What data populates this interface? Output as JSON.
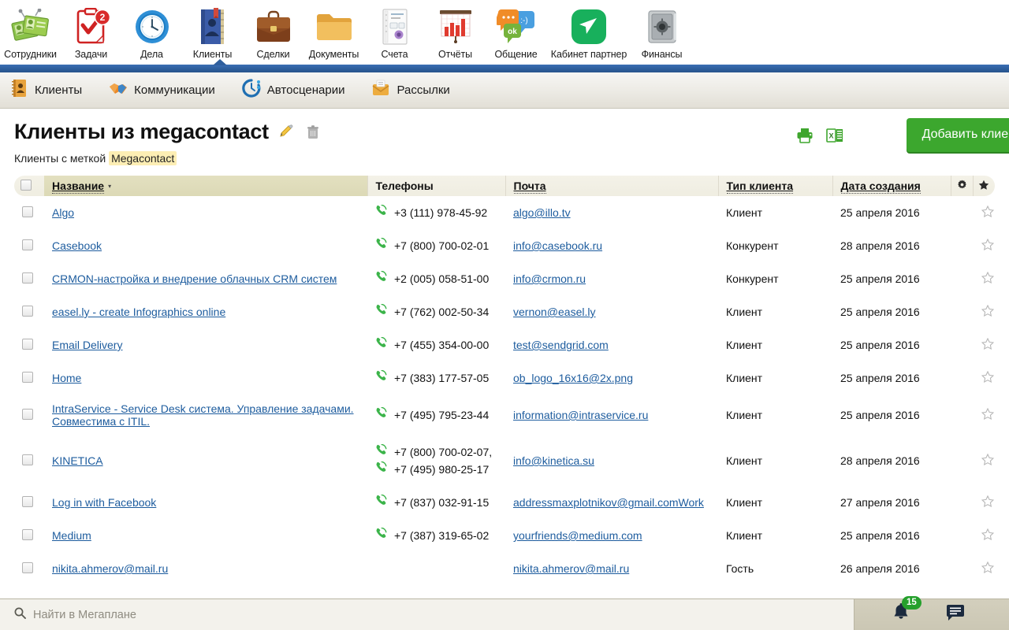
{
  "topbar": {
    "items": [
      {
        "label": "Сотрудники",
        "icon": "employees-icon",
        "badge": null
      },
      {
        "label": "Задачи",
        "icon": "tasks-clipboard-icon",
        "badge": "2"
      },
      {
        "label": "Дела",
        "icon": "clock-icon",
        "badge": null
      },
      {
        "label": "Клиенты",
        "icon": "address-book-icon",
        "badge": null,
        "active": true
      },
      {
        "label": "Сделки",
        "icon": "briefcase-icon",
        "badge": null
      },
      {
        "label": "Документы",
        "icon": "folder-icon",
        "badge": null
      },
      {
        "label": "Счета",
        "icon": "invoice-icon",
        "badge": null
      },
      {
        "label": "Отчёты",
        "icon": "bar-chart-icon",
        "badge": null
      },
      {
        "label": "Общение",
        "icon": "chat-bubbles-icon",
        "badge": null
      },
      {
        "label": "Кабинет партнер",
        "icon": "partner-cabinet-icon",
        "badge": null
      },
      {
        "label": "Финансы",
        "icon": "safe-icon",
        "badge": null
      }
    ]
  },
  "subnav": {
    "items": [
      {
        "label": "Клиенты",
        "icon": "address-book-icon",
        "active": true
      },
      {
        "label": "Коммуникации",
        "icon": "handshake-icon",
        "active": false
      },
      {
        "label": "Автосценарии",
        "icon": "auto-scenario-icon",
        "active": false
      },
      {
        "label": "Рассылки",
        "icon": "mailing-icon",
        "active": false
      }
    ]
  },
  "header": {
    "title": "Клиенты из megacontact",
    "edit_icon": "pencil-icon",
    "delete_icon": "trash-icon",
    "subtitle_prefix": "Клиенты с меткой",
    "subtitle_tag": "Megacontact",
    "print_icon": "printer-icon",
    "export_icon": "excel-export-icon",
    "add_button_label": "Добавить клиента"
  },
  "table": {
    "columns": [
      {
        "key": "select",
        "label": ""
      },
      {
        "key": "name",
        "label": "Название",
        "sorted": true,
        "sort_caret": "▾"
      },
      {
        "key": "phones",
        "label": "Телефоны"
      },
      {
        "key": "mail",
        "label": "Почта"
      },
      {
        "key": "type",
        "label": "Тип клиента"
      },
      {
        "key": "created",
        "label": "Дата создания"
      },
      {
        "key": "settings",
        "label": "",
        "icon": "gear-icon"
      },
      {
        "key": "favorite",
        "label": "",
        "icon": "star-icon"
      }
    ],
    "rows": [
      {
        "name": "Algo",
        "phones": [
          "+3 (111) 978-45-92"
        ],
        "mail": "algo@illo.tv",
        "type": "Клиент",
        "created": "25 апреля 2016",
        "starred": false
      },
      {
        "name": "Casebook",
        "phones": [
          "+7 (800) 700-02-01"
        ],
        "mail": "info@casebook.ru",
        "type": "Конкурент",
        "created": "28 апреля 2016",
        "starred": false
      },
      {
        "name": "CRMON-настройка и внедрение облачных CRM систем",
        "phones": [
          "+2 (005) 058-51-00"
        ],
        "mail": "info@crmon.ru",
        "type": "Конкурент",
        "created": "25 апреля 2016",
        "starred": false
      },
      {
        "name": "easel.ly - create Infographics online",
        "phones": [
          "+7 (762) 002-50-34"
        ],
        "mail": "vernon@easel.ly",
        "type": "Клиент",
        "created": "25 апреля 2016",
        "starred": false
      },
      {
        "name": "Email Delivery",
        "phones": [
          "+7 (455) 354-00-00"
        ],
        "mail": "test@sendgrid.com",
        "type": "Клиент",
        "created": "25 апреля 2016",
        "starred": false
      },
      {
        "name": "Home",
        "phones": [
          "+7 (383) 177-57-05"
        ],
        "mail": "ob_logo_16x16@2x.png",
        "type": "Клиент",
        "created": "25 апреля 2016",
        "starred": false
      },
      {
        "name": "IntraService - Service Desk система. Управление задачами. Совместима с ITIL.",
        "phones": [
          "+7 (495) 795-23-44"
        ],
        "mail": "information@intraservice.ru",
        "type": "Клиент",
        "created": "25 апреля 2016",
        "starred": false
      },
      {
        "name": "KINETICA",
        "phones": [
          "+7 (800) 700-02-07,",
          "+7 (495) 980-25-17"
        ],
        "mail": "info@kinetica.su",
        "type": "Клиент",
        "created": "28 апреля 2016",
        "starred": false
      },
      {
        "name": "Log in with Facebook",
        "phones": [
          "+7 (837) 032-91-15"
        ],
        "mail": "addressmaxplotnikov@gmail.comWork",
        "type": "Клиент",
        "created": "27 апреля 2016",
        "starred": false
      },
      {
        "name": "Medium",
        "phones": [
          "+7 (387) 319-65-02"
        ],
        "mail": "yourfriends@medium.com",
        "type": "Клиент",
        "created": "25 апреля 2016",
        "starred": false
      },
      {
        "name": "nikita.ahmerov@mail.ru",
        "phones": [],
        "mail": "nikita.ahmerov@mail.ru",
        "type": "Гость",
        "created": "26 апреля 2016",
        "starred": false
      }
    ]
  },
  "bottombar": {
    "search_placeholder": "Найти в Мегаплане",
    "search_icon": "search-icon",
    "bell_icon": "bell-icon",
    "notification_count": "15",
    "chat_icon": "chat-icon"
  },
  "colors": {
    "accent_green": "#3ca72e",
    "link_blue": "#1d5c9e",
    "navbar_blue": "#2f5f9e",
    "name_header_bg": "#dcd9b6",
    "header_bg": "#f1efe4",
    "bottom_bar": "#cfcbb8",
    "tag_highlight": "#fdeeb4"
  }
}
